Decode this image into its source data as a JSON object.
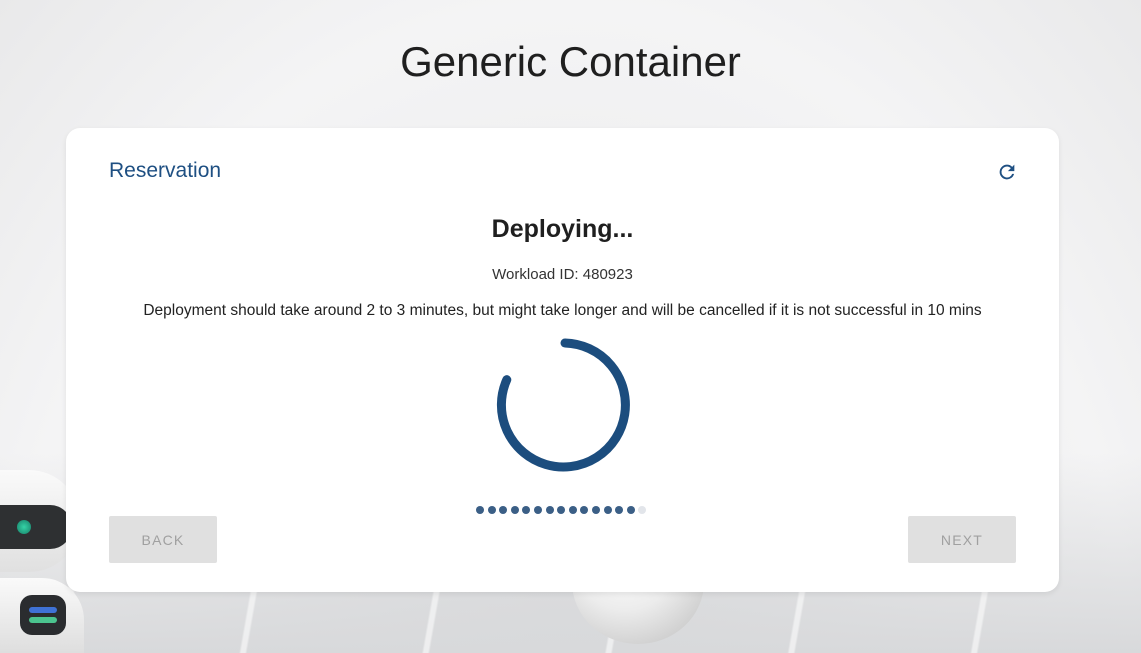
{
  "page": {
    "title": "Generic Container"
  },
  "card": {
    "title": "Reservation",
    "refresh_icon": "refresh-icon",
    "status_heading": "Deploying...",
    "workload_id_line": "Workload ID: 480923",
    "notice": "Deployment should take around 2 to 3 minutes, but might take longer and will be cancelled if it is not successful in 10 mins",
    "progress": {
      "steps_total": 15,
      "steps_completed": 14
    },
    "spinner_icon": "loading-spinner-icon"
  },
  "buttons": {
    "back_label": "BACK",
    "next_label": "NEXT",
    "back_disabled": true,
    "next_disabled": true
  },
  "colors": {
    "accent": "#1e4f82",
    "spinner": "#1c4d7e",
    "dot_active": "#3b5f86",
    "dot_pending": "#e2e5ea",
    "button_disabled_bg": "#e0e0e0",
    "button_disabled_text": "#a0a0a0"
  }
}
